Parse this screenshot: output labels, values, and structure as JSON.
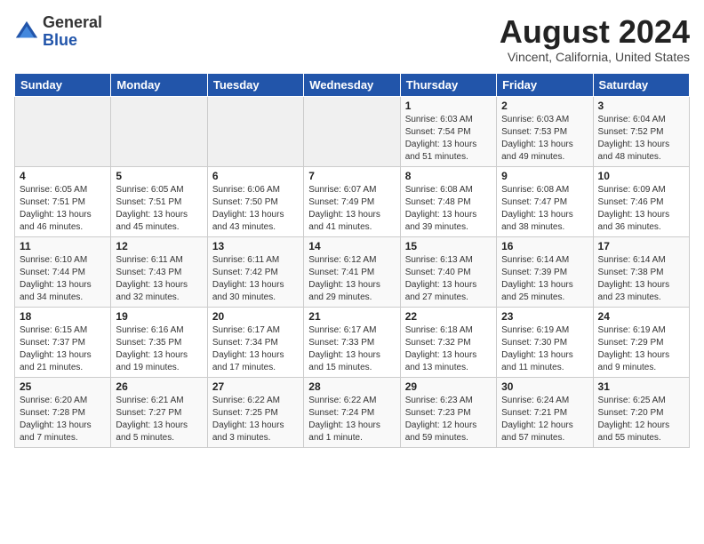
{
  "header": {
    "logo_general": "General",
    "logo_blue": "Blue",
    "month_year": "August 2024",
    "location": "Vincent, California, United States"
  },
  "weekdays": [
    "Sunday",
    "Monday",
    "Tuesday",
    "Wednesday",
    "Thursday",
    "Friday",
    "Saturday"
  ],
  "weeks": [
    [
      {
        "day": "",
        "info": ""
      },
      {
        "day": "",
        "info": ""
      },
      {
        "day": "",
        "info": ""
      },
      {
        "day": "",
        "info": ""
      },
      {
        "day": "1",
        "info": "Sunrise: 6:03 AM\nSunset: 7:54 PM\nDaylight: 13 hours\nand 51 minutes."
      },
      {
        "day": "2",
        "info": "Sunrise: 6:03 AM\nSunset: 7:53 PM\nDaylight: 13 hours\nand 49 minutes."
      },
      {
        "day": "3",
        "info": "Sunrise: 6:04 AM\nSunset: 7:52 PM\nDaylight: 13 hours\nand 48 minutes."
      }
    ],
    [
      {
        "day": "4",
        "info": "Sunrise: 6:05 AM\nSunset: 7:51 PM\nDaylight: 13 hours\nand 46 minutes."
      },
      {
        "day": "5",
        "info": "Sunrise: 6:05 AM\nSunset: 7:51 PM\nDaylight: 13 hours\nand 45 minutes."
      },
      {
        "day": "6",
        "info": "Sunrise: 6:06 AM\nSunset: 7:50 PM\nDaylight: 13 hours\nand 43 minutes."
      },
      {
        "day": "7",
        "info": "Sunrise: 6:07 AM\nSunset: 7:49 PM\nDaylight: 13 hours\nand 41 minutes."
      },
      {
        "day": "8",
        "info": "Sunrise: 6:08 AM\nSunset: 7:48 PM\nDaylight: 13 hours\nand 39 minutes."
      },
      {
        "day": "9",
        "info": "Sunrise: 6:08 AM\nSunset: 7:47 PM\nDaylight: 13 hours\nand 38 minutes."
      },
      {
        "day": "10",
        "info": "Sunrise: 6:09 AM\nSunset: 7:46 PM\nDaylight: 13 hours\nand 36 minutes."
      }
    ],
    [
      {
        "day": "11",
        "info": "Sunrise: 6:10 AM\nSunset: 7:44 PM\nDaylight: 13 hours\nand 34 minutes."
      },
      {
        "day": "12",
        "info": "Sunrise: 6:11 AM\nSunset: 7:43 PM\nDaylight: 13 hours\nand 32 minutes."
      },
      {
        "day": "13",
        "info": "Sunrise: 6:11 AM\nSunset: 7:42 PM\nDaylight: 13 hours\nand 30 minutes."
      },
      {
        "day": "14",
        "info": "Sunrise: 6:12 AM\nSunset: 7:41 PM\nDaylight: 13 hours\nand 29 minutes."
      },
      {
        "day": "15",
        "info": "Sunrise: 6:13 AM\nSunset: 7:40 PM\nDaylight: 13 hours\nand 27 minutes."
      },
      {
        "day": "16",
        "info": "Sunrise: 6:14 AM\nSunset: 7:39 PM\nDaylight: 13 hours\nand 25 minutes."
      },
      {
        "day": "17",
        "info": "Sunrise: 6:14 AM\nSunset: 7:38 PM\nDaylight: 13 hours\nand 23 minutes."
      }
    ],
    [
      {
        "day": "18",
        "info": "Sunrise: 6:15 AM\nSunset: 7:37 PM\nDaylight: 13 hours\nand 21 minutes."
      },
      {
        "day": "19",
        "info": "Sunrise: 6:16 AM\nSunset: 7:35 PM\nDaylight: 13 hours\nand 19 minutes."
      },
      {
        "day": "20",
        "info": "Sunrise: 6:17 AM\nSunset: 7:34 PM\nDaylight: 13 hours\nand 17 minutes."
      },
      {
        "day": "21",
        "info": "Sunrise: 6:17 AM\nSunset: 7:33 PM\nDaylight: 13 hours\nand 15 minutes."
      },
      {
        "day": "22",
        "info": "Sunrise: 6:18 AM\nSunset: 7:32 PM\nDaylight: 13 hours\nand 13 minutes."
      },
      {
        "day": "23",
        "info": "Sunrise: 6:19 AM\nSunset: 7:30 PM\nDaylight: 13 hours\nand 11 minutes."
      },
      {
        "day": "24",
        "info": "Sunrise: 6:19 AM\nSunset: 7:29 PM\nDaylight: 13 hours\nand 9 minutes."
      }
    ],
    [
      {
        "day": "25",
        "info": "Sunrise: 6:20 AM\nSunset: 7:28 PM\nDaylight: 13 hours\nand 7 minutes."
      },
      {
        "day": "26",
        "info": "Sunrise: 6:21 AM\nSunset: 7:27 PM\nDaylight: 13 hours\nand 5 minutes."
      },
      {
        "day": "27",
        "info": "Sunrise: 6:22 AM\nSunset: 7:25 PM\nDaylight: 13 hours\nand 3 minutes."
      },
      {
        "day": "28",
        "info": "Sunrise: 6:22 AM\nSunset: 7:24 PM\nDaylight: 13 hours\nand 1 minute."
      },
      {
        "day": "29",
        "info": "Sunrise: 6:23 AM\nSunset: 7:23 PM\nDaylight: 12 hours\nand 59 minutes."
      },
      {
        "day": "30",
        "info": "Sunrise: 6:24 AM\nSunset: 7:21 PM\nDaylight: 12 hours\nand 57 minutes."
      },
      {
        "day": "31",
        "info": "Sunrise: 6:25 AM\nSunset: 7:20 PM\nDaylight: 12 hours\nand 55 minutes."
      }
    ]
  ]
}
